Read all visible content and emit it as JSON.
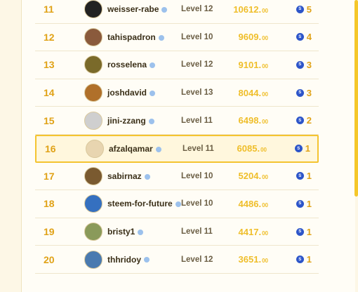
{
  "leaderboard": {
    "rows": [
      {
        "rank": "11",
        "name": "weisser-rabe",
        "level": "Level 12",
        "score": "10612.",
        "cents": "00",
        "rating": "5",
        "avatar_color": "#222222",
        "highlight": false
      },
      {
        "rank": "12",
        "name": "tahispadron",
        "level": "Level 10",
        "score": "9609.",
        "cents": "00",
        "rating": "4",
        "avatar_color": "#8a5a3c",
        "highlight": false
      },
      {
        "rank": "13",
        "name": "rosselena",
        "level": "Level 12",
        "score": "9101.",
        "cents": "00",
        "rating": "3",
        "avatar_color": "#7a6a2a",
        "highlight": false
      },
      {
        "rank": "14",
        "name": "joshdavid",
        "level": "Level 13",
        "score": "8044.",
        "cents": "00",
        "rating": "3",
        "avatar_color": "#b0702a",
        "highlight": false
      },
      {
        "rank": "15",
        "name": "jini-zzang",
        "level": "Level 11",
        "score": "6498.",
        "cents": "00",
        "rating": "2",
        "avatar_color": "#cfcfcf",
        "highlight": false
      },
      {
        "rank": "16",
        "name": "afzalqamar",
        "level": "Level 11",
        "score": "6085.",
        "cents": "00",
        "rating": "1",
        "avatar_color": "#e8d5b0",
        "highlight": true
      },
      {
        "rank": "17",
        "name": "sabirnaz",
        "level": "Level 10",
        "score": "5204.",
        "cents": "00",
        "rating": "1",
        "avatar_color": "#7a5a30",
        "highlight": false
      },
      {
        "rank": "18",
        "name": "steem-for-future",
        "level": "Level 10",
        "score": "4486.",
        "cents": "00",
        "rating": "1",
        "avatar_color": "#3570c0",
        "highlight": false
      },
      {
        "rank": "19",
        "name": "bristy1",
        "level": "Level 11",
        "score": "4417.",
        "cents": "00",
        "rating": "1",
        "avatar_color": "#8a9a5a",
        "highlight": false
      },
      {
        "rank": "20",
        "name": "thhridoy",
        "level": "Level 12",
        "score": "3651.",
        "cents": "00",
        "rating": "1",
        "avatar_color": "#4a7ab0",
        "highlight": false
      }
    ]
  },
  "colors": {
    "accent": "#f4c430",
    "rank": "#e0a217",
    "coin": "#2d55c9"
  },
  "icons": {
    "verified": "verified-badge-icon",
    "coin": "steem-coin-icon"
  }
}
